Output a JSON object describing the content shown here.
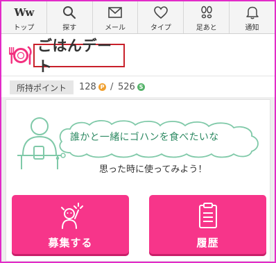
{
  "nav": {
    "items": [
      {
        "label": "トップ",
        "icon": "ww-logo-icon",
        "logo_text": "Ww"
      },
      {
        "label": "探す",
        "icon": "search-icon"
      },
      {
        "label": "メール",
        "icon": "mail-icon"
      },
      {
        "label": "タイプ",
        "icon": "heart-icon"
      },
      {
        "label": "足あと",
        "icon": "footprints-icon"
      },
      {
        "label": "通知",
        "icon": "bell-icon"
      }
    ]
  },
  "header": {
    "title": "ごはんデート",
    "icon": "plate-fork-knife-icon"
  },
  "points": {
    "label": "所持ポイント",
    "p_value": "128",
    "p_coin": "P",
    "separator": "/",
    "s_value": "526",
    "s_coin": "S"
  },
  "card": {
    "cloud_text": "誰かと一緒にゴハンを食べたいな",
    "sub_text": "思った時に使ってみよう！",
    "buttons": [
      {
        "label": "募集する",
        "icon": "raise-hand-icon"
      },
      {
        "label": "履歴",
        "icon": "clipboard-icon"
      }
    ]
  },
  "colors": {
    "frame": "#e22bc8",
    "accent_pink": "#f7358a",
    "title_border": "#c8202a",
    "illustration_green": "#7fc9a8",
    "coin_p": "#f0a030",
    "coin_s": "#55b36a"
  }
}
